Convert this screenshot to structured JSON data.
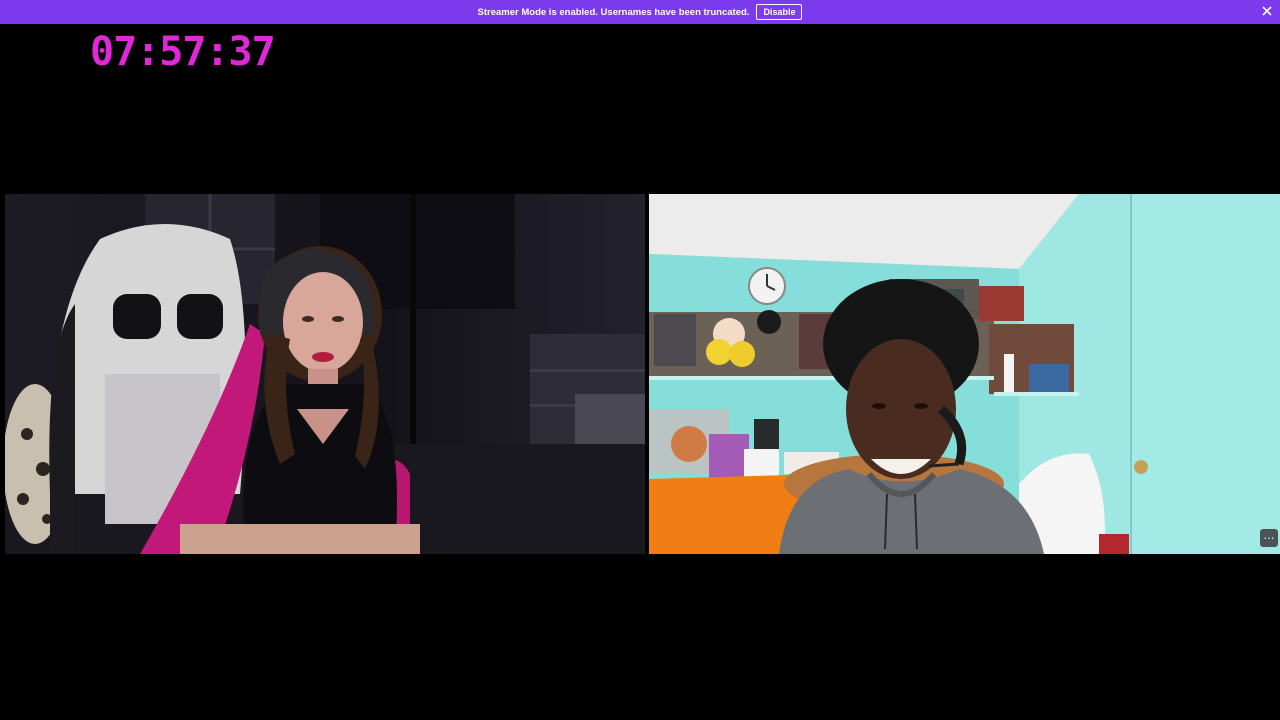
{
  "banner": {
    "message": "Streamer Mode is enabled. Usernames have been truncated.",
    "disable_label": "Disable",
    "close_icon": "close-icon",
    "color": "#7c3aed"
  },
  "timer": {
    "value": "07:57:37",
    "color": "#e028d8"
  },
  "videos": {
    "left_participant": "webcam-feed-left",
    "right_participant": "webcam-feed-right",
    "more_options_icon": "ellipsis-icon",
    "more_options_label": "…"
  }
}
